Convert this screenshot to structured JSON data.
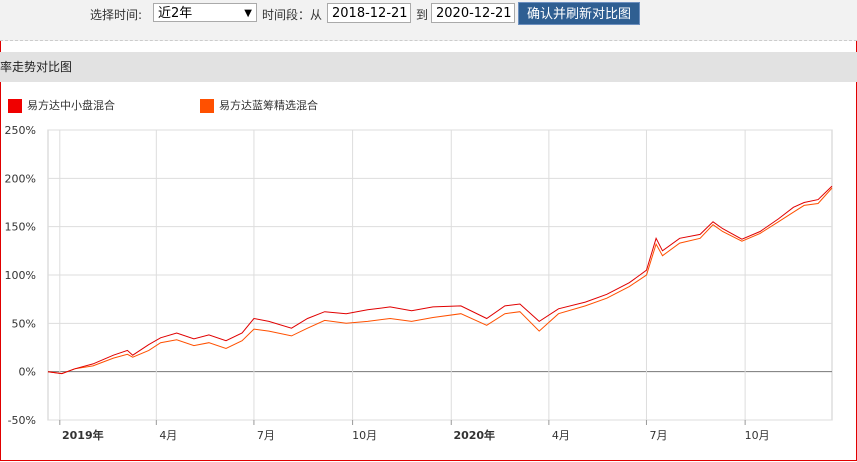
{
  "toolbar": {
    "select_time_label": "选择时间:",
    "period_value": "近2年",
    "range_label": "时间段：从",
    "start_date": "2018-12-21",
    "to_label": "到",
    "end_date": "2020-12-21",
    "confirm_button": "确认并刷新对比图"
  },
  "section_title": "率走势对比图",
  "colors": {
    "series_a": "#e00000",
    "series_b": "#ff5000"
  },
  "chart_data": {
    "type": "line",
    "title": "",
    "xlabel": "",
    "ylabel": "",
    "ylim": [
      -50,
      250
    ],
    "xlim": [
      "2018-12-21",
      "2020-12-21"
    ],
    "y_ticks": [
      "-50%",
      "0%",
      "50%",
      "100%",
      "150%",
      "200%",
      "250%"
    ],
    "x_ticks": [
      {
        "date": "2019-01-01",
        "label": "2019年",
        "bold": true
      },
      {
        "date": "2019-04-01",
        "label": "4月"
      },
      {
        "date": "2019-07-01",
        "label": "7月"
      },
      {
        "date": "2019-10-01",
        "label": "10月"
      },
      {
        "date": "2020-01-01",
        "label": "2020年",
        "bold": true
      },
      {
        "date": "2020-04-01",
        "label": "4月"
      },
      {
        "date": "2020-07-01",
        "label": "7月"
      },
      {
        "date": "2020-10-01",
        "label": "10月"
      }
    ],
    "legend_position": "top-left",
    "x": [
      "2018-12-21",
      "2019-01-03",
      "2019-01-15",
      "2019-02-01",
      "2019-02-20",
      "2019-03-05",
      "2019-03-10",
      "2019-03-25",
      "2019-04-05",
      "2019-04-20",
      "2019-05-06",
      "2019-05-20",
      "2019-06-05",
      "2019-06-20",
      "2019-07-01",
      "2019-07-15",
      "2019-08-05",
      "2019-08-20",
      "2019-09-05",
      "2019-09-25",
      "2019-10-15",
      "2019-11-05",
      "2019-11-25",
      "2019-12-15",
      "2020-01-10",
      "2020-02-03",
      "2020-02-20",
      "2020-03-05",
      "2020-03-23",
      "2020-04-10",
      "2020-05-05",
      "2020-05-25",
      "2020-06-15",
      "2020-07-01",
      "2020-07-10",
      "2020-07-16",
      "2020-08-01",
      "2020-08-20",
      "2020-09-01",
      "2020-09-10",
      "2020-09-28",
      "2020-10-15",
      "2020-11-01",
      "2020-11-15",
      "2020-11-25",
      "2020-12-08",
      "2020-12-21"
    ],
    "series": [
      {
        "name": "易方达中小盘混合",
        "values": [
          0,
          -2,
          3,
          8,
          17,
          22,
          17,
          28,
          35,
          40,
          34,
          38,
          32,
          40,
          55,
          52,
          45,
          55,
          62,
          60,
          64,
          67,
          63,
          67,
          68,
          55,
          68,
          70,
          52,
          65,
          72,
          80,
          92,
          105,
          138,
          125,
          138,
          142,
          155,
          148,
          137,
          145,
          158,
          170,
          175,
          178,
          192
        ]
      },
      {
        "name": "易方达蓝筹精选混合",
        "values": [
          0,
          -2,
          3,
          6,
          14,
          18,
          15,
          22,
          30,
          33,
          27,
          30,
          24,
          32,
          44,
          42,
          37,
          45,
          53,
          50,
          52,
          55,
          52,
          56,
          60,
          48,
          60,
          62,
          42,
          60,
          68,
          76,
          88,
          100,
          132,
          120,
          133,
          138,
          152,
          145,
          135,
          143,
          155,
          165,
          172,
          174,
          190
        ]
      }
    ]
  }
}
